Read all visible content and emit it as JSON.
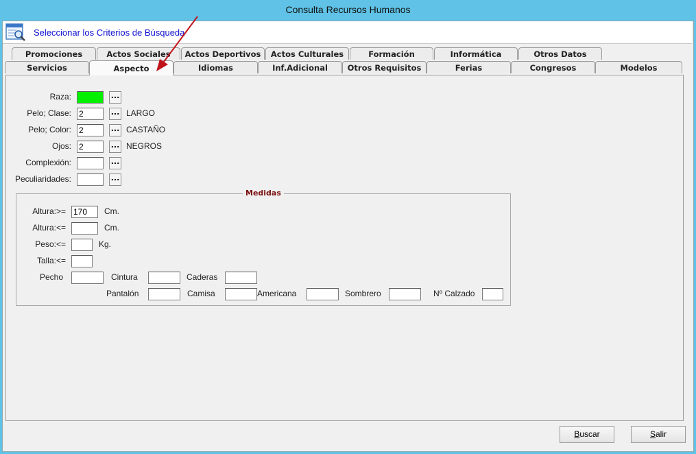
{
  "window": {
    "title": "Consulta Recursos Humanos"
  },
  "header": {
    "title": "Seleccionar los Criterios de Búsqueda",
    "icon": "search-form-icon"
  },
  "tabs_top": [
    "Promociones",
    "Actos Sociales",
    "Actos Deportivos",
    "Actos Culturales",
    "Formación",
    "Informática",
    "Otros Datos"
  ],
  "tabs_bottom": [
    "Servicios",
    "Aspecto",
    "Idiomas",
    "Inf.Adicional",
    "Otros Requisitos",
    "Ferias",
    "Congresos",
    "Modelos"
  ],
  "active_tab": "Aspecto",
  "fields": [
    {
      "label": "Raza:",
      "value": "",
      "desc": ""
    },
    {
      "label": "Pelo; Clase:",
      "value": "2",
      "desc": "LARGO"
    },
    {
      "label": "Pelo; Color:",
      "value": "2",
      "desc": "CASTAÑO"
    },
    {
      "label": "Ojos:",
      "value": "2",
      "desc": "NEGROS"
    },
    {
      "label": "Complexión:",
      "value": "",
      "desc": ""
    },
    {
      "label": "Peculiaridades:",
      "value": "",
      "desc": ""
    }
  ],
  "lookup_button_label": "...",
  "medidas": {
    "title": "Medidas",
    "altura_min": {
      "label": "Altura:>=",
      "value": "170",
      "unit": "Cm."
    },
    "altura_max": {
      "label": "Altura:<=",
      "value": "",
      "unit": "Cm."
    },
    "peso": {
      "label": "Peso:<=",
      "value": "",
      "unit": "Kg."
    },
    "talla": {
      "label": "Talla:<=",
      "value": ""
    },
    "pecho": {
      "label": "Pecho",
      "value": ""
    },
    "cintura": {
      "label": "Cintura",
      "value": ""
    },
    "caderas": {
      "label": "Caderas",
      "value": ""
    },
    "pantalon": {
      "label": "Pantalón",
      "value": ""
    },
    "camisa": {
      "label": "Camisa",
      "value": ""
    },
    "americana": {
      "label": "Americana",
      "value": ""
    },
    "sombrero": {
      "label": "Sombrero",
      "value": ""
    },
    "calzado": {
      "label": "Nº Calzado",
      "value": ""
    }
  },
  "buttons": {
    "buscar_first": "B",
    "buscar_rest": "uscar",
    "salir_first": "S",
    "salir_rest": "alir"
  },
  "colors": {
    "active_field": "#00f000",
    "title_bar": "#5fc2e6",
    "header_text": "#1010d0",
    "group_title": "#7a1010",
    "annotation_arrow": "#c0141c"
  }
}
